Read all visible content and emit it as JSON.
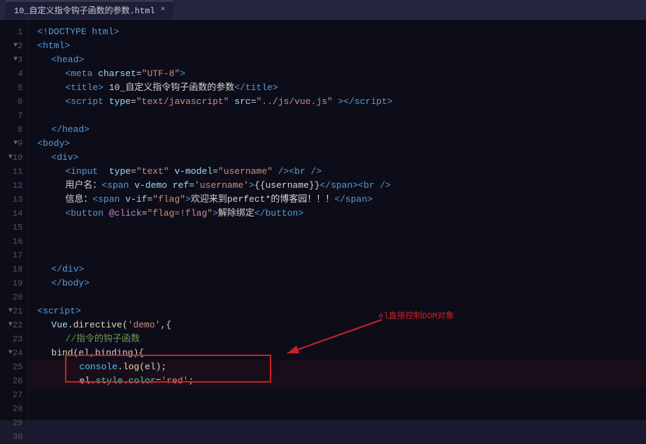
{
  "titleBar": {
    "tabName": "10_自定义指令钩子函数的参数.html",
    "closeIcon": "×"
  },
  "lines": [
    {
      "num": 1,
      "fold": false,
      "content": "doctype"
    },
    {
      "num": 2,
      "fold": true,
      "content": "html_open"
    },
    {
      "num": 3,
      "fold": true,
      "content": "head_open"
    },
    {
      "num": 4,
      "fold": false,
      "content": "meta"
    },
    {
      "num": 5,
      "fold": false,
      "content": "title"
    },
    {
      "num": 6,
      "fold": false,
      "content": "script_src"
    },
    {
      "num": 7,
      "fold": false,
      "content": "blank"
    },
    {
      "num": 8,
      "fold": false,
      "content": "head_close"
    },
    {
      "num": 9,
      "fold": true,
      "content": "body_open"
    },
    {
      "num": 10,
      "fold": true,
      "content": "div_open"
    },
    {
      "num": 11,
      "fold": false,
      "content": "input_line"
    },
    {
      "num": 12,
      "fold": false,
      "content": "username_line"
    },
    {
      "num": 13,
      "fold": false,
      "content": "info_line"
    },
    {
      "num": 14,
      "fold": false,
      "content": "button_line"
    },
    {
      "num": 15,
      "fold": false,
      "content": "blank"
    },
    {
      "num": 16,
      "fold": false,
      "content": "blank"
    },
    {
      "num": 17,
      "fold": false,
      "content": "blank"
    },
    {
      "num": 18,
      "fold": false,
      "content": "div_close"
    },
    {
      "num": 19,
      "fold": false,
      "content": "body_close"
    },
    {
      "num": 20,
      "fold": false,
      "content": "blank"
    },
    {
      "num": 21,
      "fold": true,
      "content": "script_open"
    },
    {
      "num": 22,
      "fold": false,
      "content": "vue_directive"
    },
    {
      "num": 23,
      "fold": false,
      "content": "js_comment"
    },
    {
      "num": 24,
      "fold": false,
      "content": "bind_func"
    },
    {
      "num": 25,
      "fold": false,
      "content": "console_log",
      "highlight": true
    },
    {
      "num": 26,
      "fold": false,
      "content": "el_style",
      "highlight": true
    },
    {
      "num": 27,
      "fold": false,
      "content": "blank"
    },
    {
      "num": 28,
      "fold": false,
      "content": "blank"
    },
    {
      "num": 29,
      "fold": false,
      "content": "blank"
    },
    {
      "num": 30,
      "fold": false,
      "content": "closing_brace"
    }
  ],
  "annotation": {
    "text": "el直接控制DOM对象",
    "arrowVisible": true
  }
}
